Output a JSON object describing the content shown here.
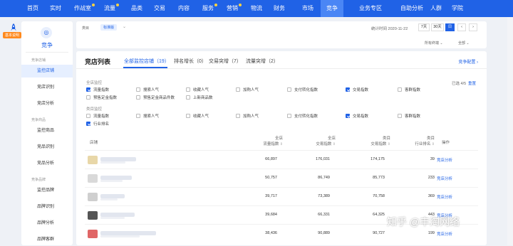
{
  "topnav": {
    "items": [
      {
        "label": "首页",
        "dot": false,
        "active": false
      },
      {
        "label": "实时",
        "dot": false,
        "active": false
      },
      {
        "label": "作战室",
        "dot": true,
        "active": false
      },
      {
        "label": "流量",
        "dot": true,
        "active": false
      },
      {
        "label": "品类",
        "dot": false,
        "active": false
      },
      {
        "label": "交易",
        "dot": false,
        "active": false
      },
      {
        "label": "内容",
        "dot": false,
        "active": false
      },
      {
        "label": "服务",
        "dot": true,
        "active": false
      },
      {
        "label": "营销",
        "dot": true,
        "active": false
      },
      {
        "label": "物流",
        "dot": false,
        "active": false
      },
      {
        "label": "财务",
        "dot": false,
        "active": false
      },
      {
        "label": "市场",
        "dot": false,
        "active": false
      },
      {
        "label": "竞争",
        "dot": false,
        "active": true
      },
      {
        "label": "业务专区",
        "dot": false,
        "active": false
      },
      {
        "label": "自助分析",
        "dot": false,
        "active": false
      },
      {
        "label": "人群",
        "dot": false,
        "active": false
      },
      {
        "label": "学院",
        "dot": false,
        "active": false
      }
    ],
    "accent": "#2062e6"
  },
  "help_badge": "基本说明",
  "subnav": {
    "title": "竞争",
    "groups": [
      {
        "label": "竞争店铺",
        "items": [
          {
            "label": "监控店铺",
            "active": true
          },
          {
            "label": "竞店识别",
            "active": false
          },
          {
            "label": "竞店分析",
            "active": false
          }
        ]
      },
      {
        "label": "竞争商品",
        "items": [
          {
            "label": "监控商品",
            "active": false
          },
          {
            "label": "竞品识别",
            "active": false
          },
          {
            "label": "竞品分析",
            "active": false
          }
        ]
      },
      {
        "label": "竞争品牌",
        "items": [
          {
            "label": "监控品牌",
            "active": false
          },
          {
            "label": "品牌识别",
            "active": false
          },
          {
            "label": "品牌分析",
            "active": false
          },
          {
            "label": "品牌客群",
            "active": false
          }
        ]
      }
    ]
  },
  "filterbar": {
    "label": "类目",
    "tag": "标准版",
    "stat_time": "统计时间 2020-11-22",
    "ranges": [
      "7天",
      "30天",
      "日"
    ],
    "active_range": "日",
    "prev": "‹",
    "next": "›",
    "dropdown_terminal": "所有终端",
    "dropdown_all": "全部"
  },
  "card": {
    "title": "竞店列表",
    "tabs": [
      {
        "label": "全部监控店铺（19）",
        "active": true
      },
      {
        "label": "排名增长（0）",
        "active": false
      },
      {
        "label": "交易突增（7）",
        "active": false
      },
      {
        "label": "流量突增（2）",
        "active": false
      }
    ],
    "config_link": "竞争配置 ›",
    "selected": "已选 4/5",
    "reset": "重置",
    "shop_group": {
      "label": "全店监控",
      "rows": [
        [
          {
            "label": "流量指数",
            "checked": true
          },
          {
            "label": "搜索人气",
            "checked": false
          },
          {
            "label": "收藏人气",
            "checked": false
          },
          {
            "label": "加购人气",
            "checked": false
          },
          {
            "label": "支付转化指数",
            "checked": false
          },
          {
            "label": "交易指数",
            "checked": true
          },
          {
            "label": "客群指数",
            "checked": false
          }
        ],
        [
          {
            "label": "预售定金指数",
            "checked": false
          },
          {
            "label": "预售定金商品件数",
            "checked": false
          },
          {
            "label": "上新商品数",
            "checked": false
          }
        ]
      ]
    },
    "cat_group": {
      "label": "类目监控",
      "rows": [
        [
          {
            "label": "流量指数",
            "checked": false
          },
          {
            "label": "搜索人气",
            "checked": false
          },
          {
            "label": "收藏人气",
            "checked": false
          },
          {
            "label": "加购人气",
            "checked": false
          },
          {
            "label": "支付转化指数",
            "checked": false
          },
          {
            "label": "交易指数",
            "checked": true
          },
          {
            "label": "客群指数",
            "checked": false
          }
        ],
        [
          {
            "label": "行业排名",
            "checked": true
          }
        ]
      ]
    },
    "table": {
      "col_shop": "店铺",
      "col_ops": "操作",
      "columns": [
        {
          "line1": "全店",
          "line2": "流量指数"
        },
        {
          "line1": "全店",
          "line2": "交易指数"
        },
        {
          "line1": "类目",
          "line2": "交易指数"
        },
        {
          "line1": "类目",
          "line2": "行业排名"
        }
      ],
      "rows": [
        {
          "traffic": "66,897",
          "trade": "176,031",
          "cat_trade": "174,175",
          "rank": "39",
          "op": "竞店分析",
          "thumb": "#e8d7a8"
        },
        {
          "traffic": "50,757",
          "trade": "86,749",
          "cat_trade": "85,773",
          "rank": "233",
          "op": "竞店分析",
          "thumb": "#d9d9d9"
        },
        {
          "traffic": "39,717",
          "trade": "73,389",
          "cat_trade": "70,758",
          "rank": "369",
          "op": "竞店分析",
          "thumb": "#cfcfcf"
        },
        {
          "traffic": "39,684",
          "trade": "66,331",
          "cat_trade": "64,325",
          "rank": "443",
          "op": "竞店分析",
          "thumb": "#555555"
        },
        {
          "traffic": "38,436",
          "trade": "90,889",
          "cat_trade": "90,727",
          "rank": "199",
          "op": "竞店分析",
          "thumb": "#e06666"
        }
      ]
    }
  },
  "watermark": "知乎 @丰淘网络"
}
